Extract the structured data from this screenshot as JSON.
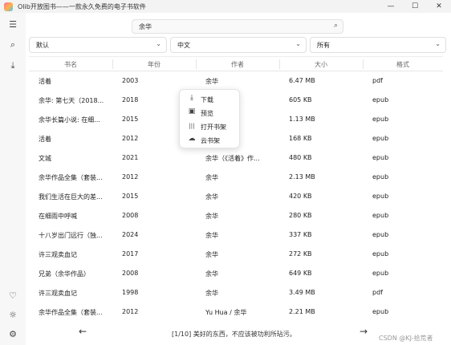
{
  "window": {
    "title": "Olib开放图书——一款永久免费的电子书软件",
    "btn_min": "—",
    "btn_max": "☐",
    "btn_close": "✕"
  },
  "sidebar": {
    "menu": "☰",
    "search": "⌕",
    "download": "⤓",
    "favorite": "♡",
    "theme": "☼",
    "settings": "⚙"
  },
  "search": {
    "query": "余华",
    "icon": "⌕"
  },
  "filters": [
    {
      "label": "默认",
      "chev": "⌄"
    },
    {
      "label": "中文",
      "chev": "⌄"
    },
    {
      "label": "所有",
      "chev": "⌄"
    }
  ],
  "table": {
    "columns": [
      "书名",
      "年份",
      "作者",
      "大小",
      "格式"
    ],
    "rows": [
      [
        "活着",
        "2003",
        "余华",
        "6.47 MB",
        "pdf"
      ],
      [
        "余华: 第七天（2018...",
        "2018",
        "",
        "605 KB",
        "epub"
      ],
      [
        "余华长篇小说: 在细...",
        "2015",
        "",
        "1.13 MB",
        "epub"
      ],
      [
        "活着",
        "2012",
        "",
        "168 KB",
        "epub"
      ],
      [
        "文城",
        "2021",
        "余华（《活着》作...",
        "480 KB",
        "epub"
      ],
      [
        "余华作品全集（套装...",
        "2012",
        "余华",
        "2.13 MB",
        "epub"
      ],
      [
        "我们生活在巨大的差...",
        "2015",
        "余华",
        "420 KB",
        "epub"
      ],
      [
        "在细雨中呼喊",
        "2008",
        "余华",
        "280 KB",
        "epub"
      ],
      [
        "十八岁出门远行（独...",
        "2024",
        "余华",
        "337 KB",
        "epub"
      ],
      [
        "许三观卖血记",
        "2017",
        "余华",
        "272 KB",
        "epub"
      ],
      [
        "兄弟（余华作品）",
        "2008",
        "余华",
        "649 KB",
        "epub"
      ],
      [
        "许三观卖血记",
        "1998",
        "余华",
        "3.49 MB",
        "pdf"
      ],
      [
        "余华作品全集（套装...",
        "2012",
        "Yu Hua / 余华",
        "2.21 MB",
        "epub"
      ]
    ]
  },
  "context_menu": {
    "items": [
      {
        "icon": "⤓",
        "label": "下载"
      },
      {
        "icon": "▣",
        "label": "预览"
      },
      {
        "icon": "|||",
        "label": "打开书架"
      },
      {
        "icon": "☁",
        "label": "云书架"
      }
    ]
  },
  "pager": {
    "prev": "←",
    "next": "→",
    "text": "[1/10] 美好的东西，不应该被功利所玷污。"
  },
  "watermark": "CSDN @KJ-拾荒者"
}
